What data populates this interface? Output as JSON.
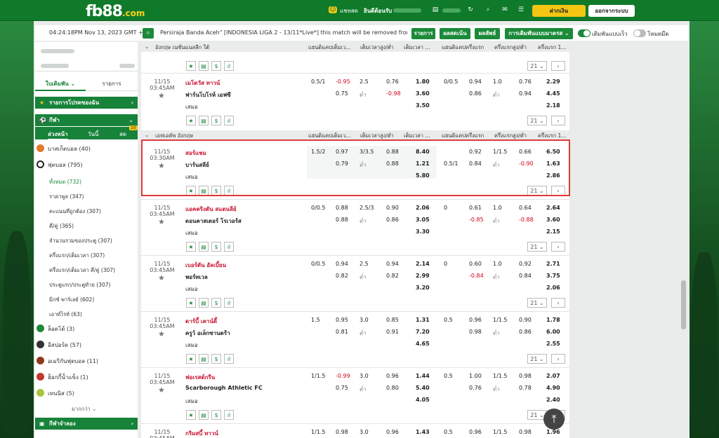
{
  "topbar": {
    "logo": "fb88",
    "logo_suffix": ".com",
    "chat": "แชทสด",
    "welcome": "ยินดีต้อนรับ",
    "deposit": "ฝากเงิน",
    "logout": "ออกจากระบบ"
  },
  "infobar": {
    "time": "04:24:18PM Nov 13, 2023 GMT +8",
    "ticker": "Persiraja Banda Aceh\" [INDONESIA LIGA 2 - 13/11*Live*] this match will be removed from",
    "btn_rules": "รายการ",
    "btn_results": "ผลสดเน้น",
    "btn_stats": "ผลลัพธ์",
    "select_label": "การเดิมพันแบบมาตรส",
    "toggle1_label": "เดิมพันแบบเร็ว",
    "toggle2_label": "โหมดมืด"
  },
  "sidebar": {
    "tab_bet": "ใบเดิมพัน",
    "tab_list": "รายการ",
    "fav": "รายการโปรดของฉัน",
    "sports": "กีฬา",
    "sub_tabs": [
      "ล่วงหน้า",
      "วันนี้",
      "สด"
    ],
    "live_badge": "10",
    "items": [
      {
        "label": "บาสเก็ตบอล (40)",
        "color": "#e27b2a"
      },
      {
        "label": "ฟุตบอล (795)",
        "color": "#222222"
      }
    ],
    "football_sub": [
      "ทั้งหมด (732)",
      "ราคาพูล (347)",
      "คะแนนที่ถูกต้อง (307)",
      "คี่/คู่ (365)",
      "จำนวนรวมของประตู (307)",
      "ครึ่งแรก/เต็มเวลา (307)",
      "ครึ่งแรก/เต็มเวลา คี่/คู่ (307)",
      "ประตูแรก/ประตูท้าย (307)",
      "มิกซ์ พาร์เลย์ (602)",
      "เอาท์ไรท์ (63)"
    ],
    "more_items": [
      {
        "label": "ล็อตโต้ (3)",
        "color": "#1b8a3a"
      },
      {
        "label": "อีสปอร์ต (57)",
        "color": "#333333"
      },
      {
        "label": "อเมริกันฟุตบอล (11)",
        "color": "#8b3a1a"
      },
      {
        "label": "ฮ็อกกี้น้ำแข็ง (1)",
        "color": "#c0392b"
      },
      {
        "label": "เทนนิส (5)",
        "color": "#a8c43a"
      }
    ],
    "more": "มากกว่า",
    "virtual": "กีฬาจำลอง"
  },
  "leagues": [
    {
      "name": "อังกฤษ เนชั่นแนลลีก ใต้"
    },
    {
      "name": "เอฟเอคัพ อังกฤษ"
    }
  ],
  "columns": [
    "แฮนดิแคปเต็มเว...",
    "เต็มเวลาสูง/ต่ำ",
    "เต็มเวลา ...",
    "แฮนดิแคปครึ่งแรก",
    "ครึ่งแรกสูง/ต่ำ",
    "ครึ่งแรก 1..."
  ],
  "draw_label": "เสมอ",
  "under_label": "ต่ำ",
  "page_select": "21",
  "matches": [
    {
      "date": "11/15",
      "time": "03:45AM",
      "home": "เมโดวัส ทาวน์",
      "away": "ฟาร์นโบโรห์ เอฟซี",
      "hdp": "0.5/1",
      "hdp_h": "-0.95",
      "hdp_a": "0.75",
      "ou": "2.5",
      "ou_o": "0.76",
      "ou_u": "-0.98",
      "x1": "1.80",
      "x2": "3.60",
      "xd": "3.50",
      "fh_hdp": "0/0.5",
      "fh_h": "0.94",
      "fh_a": "0.86",
      "fh_ou": "1.0",
      "fh_o": "0.76",
      "fh_u": "0.94",
      "fx1": "2.29",
      "fx2": "4.45",
      "fxd": "2.18"
    },
    {
      "date": "11/15",
      "time": "03:30AM",
      "home": "สอร์แชม",
      "away": "บาร์นสลีย์",
      "hdp": "1.5/2",
      "hdp_h": "0.97",
      "hdp_a": "0.79",
      "ou": "3/3.5",
      "ou_o": "0.88",
      "ou_u": "0.88",
      "x1": "8.40",
      "x2": "1.21",
      "xd": "5.80",
      "fh_hdp": "0.5/1",
      "fh_h": "0.92",
      "fh_a": "0.84",
      "fh_ou": "1/1.5",
      "fh_o": "0.66",
      "fh_u": "-0.90",
      "fx1": "6.50",
      "fx2": "1.63",
      "fxd": "2.86"
    },
    {
      "date": "11/15",
      "time": "03:45AM",
      "home": "แอคคริงตัน สแตนลีย์",
      "away": "ดอนคาสเตอร์ โรเวอร์ส",
      "hdp": "0/0.5",
      "hdp_h": "0.88",
      "hdp_a": "0.88",
      "ou": "2.5/3",
      "ou_o": "0.90",
      "ou_u": "0.86",
      "x1": "2.06",
      "x2": "3.05",
      "xd": "3.30",
      "fh_hdp": "0",
      "fh_h": "0.61",
      "fh_a": "-0.85",
      "fh_ou": "1.0",
      "fh_o": "0.64",
      "fh_u": "-0.88",
      "fx1": "2.64",
      "fx2": "3.60",
      "fxd": "2.15"
    },
    {
      "date": "11/15",
      "time": "03:45AM",
      "home": "เบอร์ตัน อัลเบี้ยน",
      "away": "พอร์ทเวล",
      "hdp": "0/0.5",
      "hdp_h": "0.94",
      "hdp_a": "0.82",
      "ou": "2.5",
      "ou_o": "0.94",
      "ou_u": "0.82",
      "x1": "2.14",
      "x2": "2.99",
      "xd": "3.20",
      "fh_hdp": "0",
      "fh_h": "0.60",
      "fh_a": "-0.84",
      "fh_ou": "1.0",
      "fh_o": "0.92",
      "fh_u": "0.84",
      "fx1": "2.71",
      "fx2": "3.75",
      "fxd": "2.06"
    },
    {
      "date": "11/15",
      "time": "03:45AM",
      "home": "ดาร์บี้ เคาน์ตี้",
      "away": "ครูว์ อเล็กซานดร้า",
      "hdp": "1.5",
      "hdp_h": "0.95",
      "hdp_a": "0.81",
      "ou": "3.0",
      "ou_o": "0.85",
      "ou_u": "0.91",
      "x1": "1.31",
      "x2": "7.20",
      "xd": "4.65",
      "fh_hdp": "0.5",
      "fh_h": "0.96",
      "fh_a": "0.98",
      "fh_ou": "1/1.5",
      "fh_o": "0.90",
      "fh_u": "0.86",
      "fx1": "1.78",
      "fx2": "6.00",
      "fxd": "2.55"
    },
    {
      "date": "11/15",
      "time": "03:45AM",
      "home": "ฟอเรสต์กรีน",
      "away": "Scarborough Athletic FC",
      "hdp": "1/1.5",
      "hdp_h": "-0.99",
      "hdp_a": "0.75",
      "ou": "3.0",
      "ou_o": "0.96",
      "ou_u": "0.80",
      "x1": "1.44",
      "x2": "5.40",
      "xd": "4.05",
      "fh_hdp": "0.5",
      "fh_h": "1.00",
      "fh_a": "0.76",
      "fh_ou": "1/1.5",
      "fh_o": "0.98",
      "fh_u": "0.78",
      "fx1": "2.07",
      "fx2": "4.90",
      "fxd": "2.40"
    },
    {
      "date": "11/15",
      "time": "03:45AM",
      "home": "กริมสบี้ ทาวน์",
      "away": "",
      "hdp": "1/1.5",
      "hdp_h": "0.98",
      "hdp_a": "",
      "ou": "3.0",
      "ou_o": "0.96",
      "ou_u": "",
      "x1": "1.43",
      "x2": "",
      "xd": "",
      "fh_hdp": "0.5",
      "fh_h": "0.96",
      "fh_a": "",
      "fh_ou": "1/1.5",
      "fh_o": "0.98",
      "fh_u": "",
      "fx1": "1.96",
      "fx2": "",
      "fxd": ""
    }
  ]
}
